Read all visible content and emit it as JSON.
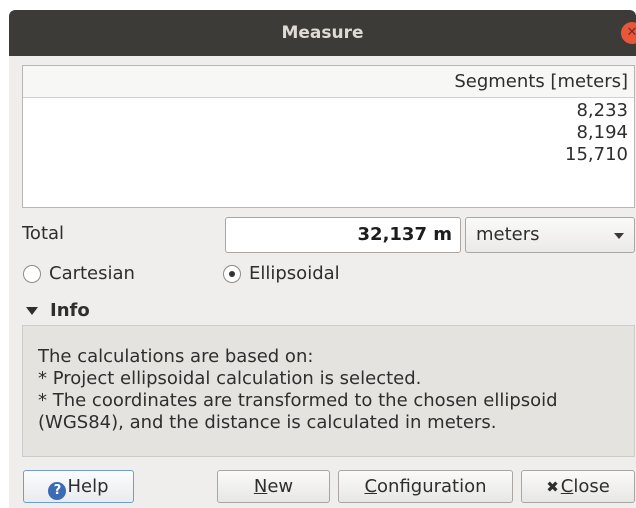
{
  "window": {
    "title": "Measure"
  },
  "table": {
    "header": "Segments [meters]",
    "rows": [
      "8,233",
      "8,194",
      "15,710"
    ]
  },
  "total": {
    "label": "Total",
    "value": "32,137 m",
    "unit_selected": "meters"
  },
  "mode": {
    "cartesian_label": "Cartesian",
    "ellipsoidal_label": "Ellipsoidal",
    "selected": "Ellipsoidal"
  },
  "info": {
    "header": "Info",
    "lines": [
      "The calculations are based on:",
      "* Project ellipsoidal calculation is selected.",
      "* The coordinates are transformed to the chosen ellipsoid",
      "(WGS84), and the distance is calculated in meters."
    ]
  },
  "buttons": {
    "help_label": "Help",
    "new_label": "New",
    "configuration_label": "Configuration",
    "close_label": "Close"
  },
  "icons": {
    "help": "help-icon",
    "close": "close-icon",
    "window_close": "window-close-icon"
  },
  "colors": {
    "titlebar": "#3c3b37",
    "close_button": "#e9573a",
    "help_icon": "#3b6bb4"
  }
}
